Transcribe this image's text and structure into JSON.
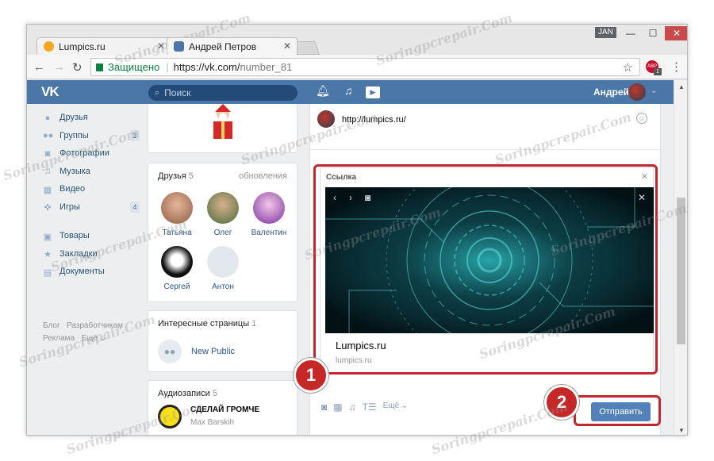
{
  "browser": {
    "tabs": [
      {
        "title": "Lumpics.ru",
        "favicon_color": "#f5a623"
      },
      {
        "title": "Андрей Петров",
        "favicon_color": "#4a76a8"
      }
    ],
    "profile_label": "JAN",
    "secure_label": "Защищено",
    "url_main": "https://vk.com/",
    "url_rest": "number_81",
    "extension_badge_count": "1"
  },
  "vk": {
    "search_placeholder": "Поиск",
    "username": "Андрей",
    "left_nav": [
      {
        "label": "Друзья",
        "icon": "user-icon",
        "count": ""
      },
      {
        "label": "Группы",
        "icon": "group-icon",
        "count": "1"
      },
      {
        "label": "Фотографии",
        "icon": "camera-icon",
        "count": ""
      },
      {
        "label": "Музыка",
        "icon": "music-icon",
        "count": ""
      },
      {
        "label": "Видео",
        "icon": "video-icon",
        "count": ""
      },
      {
        "label": "Игры",
        "icon": "gamepad-icon",
        "count": "4"
      }
    ],
    "left_nav_secondary": [
      {
        "label": "Товары",
        "icon": "bag-icon"
      },
      {
        "label": "Закладки",
        "icon": "star-icon"
      },
      {
        "label": "Документы",
        "icon": "document-icon"
      }
    ],
    "footer_links": [
      "Блог",
      "Разработчикам",
      "Реклама",
      "Ещё ⌄"
    ],
    "friends": {
      "title": "Друзья",
      "count": "5",
      "link": "обновления",
      "people": [
        {
          "name": "Татьяна"
        },
        {
          "name": "Олег"
        },
        {
          "name": "Валентин"
        },
        {
          "name": "Сергей"
        },
        {
          "name": "Антон"
        }
      ]
    },
    "pages": {
      "title": "Интересные страницы",
      "count": "1",
      "item": "New Public"
    },
    "audio": {
      "title": "Аудиозаписи",
      "count": "5",
      "track": "СДЕЛАЙ ГРОМЧЕ",
      "artist": "Max Barskih"
    },
    "composer": {
      "text": "http://lumpics.ru/",
      "link_label": "Ссылка",
      "link_title": "Lumpics.ru",
      "link_host": "lumpics.ru",
      "more_label": "Ещё",
      "send_label": "Отправить"
    }
  },
  "annotations": {
    "step1": "1",
    "step2": "2",
    "outline_color": "#c2262e"
  },
  "watermark": "Soringpcrepair.Com"
}
